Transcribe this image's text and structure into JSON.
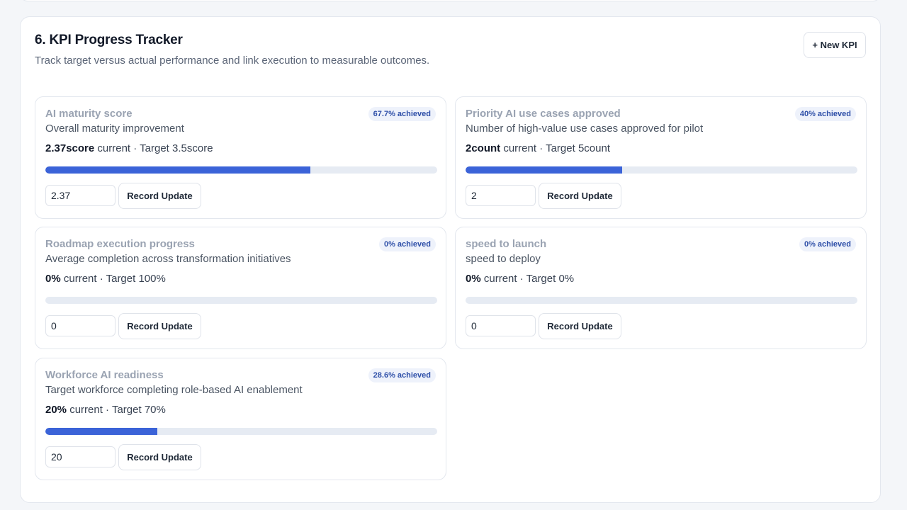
{
  "section": {
    "title": "6. KPI Progress Tracker",
    "subtitle": "Track target versus actual performance and link execution to measurable outcomes.",
    "new_button_label": "+ New KPI"
  },
  "record_label": "Record Update",
  "current_suffix": " current · Target ",
  "colors": {
    "bar_fill": "#3b63d8",
    "bar_track": "#e6ebf3",
    "badge_text": "#2e4fa8"
  },
  "kpis": [
    {
      "name": "AI maturity score",
      "description": "Overall maturity improvement",
      "badge": "67.7% achieved",
      "current": "2.37score",
      "target": "3.5score",
      "progress_pct": 67.7,
      "input_value": "2.37"
    },
    {
      "name": "Priority AI use cases approved",
      "description": "Number of high-value use cases approved for pilot",
      "badge": "40% achieved",
      "current": "2count",
      "target": "5count",
      "progress_pct": 40,
      "input_value": "2"
    },
    {
      "name": "Roadmap execution progress",
      "description": "Average completion across transformation initiatives",
      "badge": "0% achieved",
      "current": "0%",
      "target": "100%",
      "progress_pct": 0,
      "input_value": "0"
    },
    {
      "name": "speed to launch",
      "description": "speed to deploy",
      "badge": "0% achieved",
      "current": "0%",
      "target": "0%",
      "progress_pct": 0,
      "input_value": "0"
    },
    {
      "name": "Workforce AI readiness",
      "description": "Target workforce completing role-based AI enablement",
      "badge": "28.6% achieved",
      "current": "20%",
      "target": "70%",
      "progress_pct": 28.6,
      "input_value": "20"
    }
  ]
}
